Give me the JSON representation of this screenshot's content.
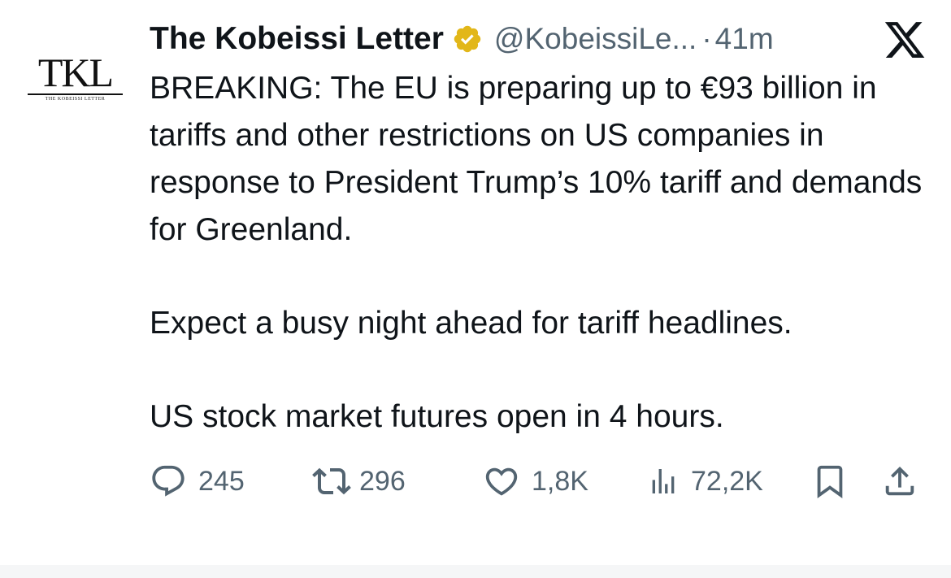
{
  "author": {
    "avatar_mark": "TKL",
    "avatar_caption": "THE KOBEISSI LETTER",
    "display_name": "The Kobeissi Letter",
    "handle": "@KobeissiLe...",
    "separator": "·",
    "time": "41m"
  },
  "icons": {
    "verified": "verified-gold-badge-icon",
    "platform": "x-logo-icon",
    "reply": "reply-bubble-icon",
    "repost": "repost-arrows-icon",
    "like": "heart-icon",
    "views": "bar-chart-icon",
    "bookmark": "bookmark-icon",
    "share": "share-upload-icon"
  },
  "colors": {
    "verified_gold": "#E2B719",
    "text_primary": "#0F1419",
    "text_secondary": "#536471"
  },
  "tweet": {
    "paragraphs": [
      "BREAKING: The EU is preparing up to €93 billion in tariffs and other restrictions on US companies in response to President Trump’s 10% tariff and demands for Greenland.",
      "Expect a busy night ahead for tariff headlines.",
      "US stock market futures open in 4 hours."
    ]
  },
  "metrics": {
    "replies": "245",
    "reposts": "296",
    "likes": "1,8K",
    "views": "72,2K"
  }
}
